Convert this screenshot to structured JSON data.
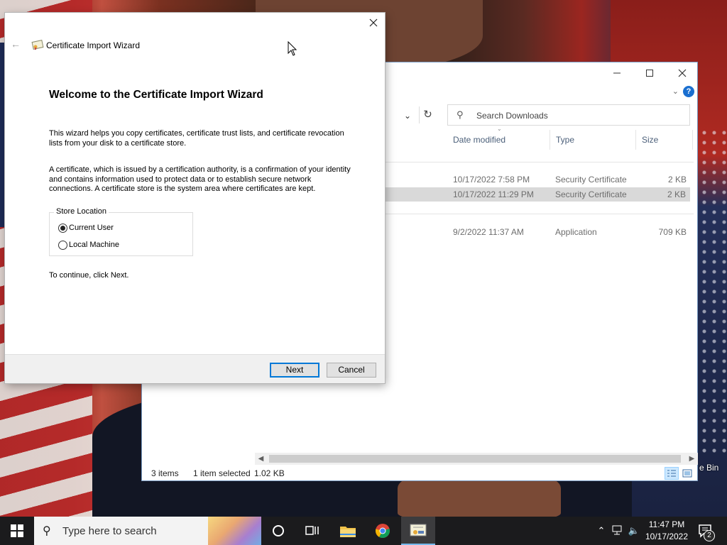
{
  "desktop": {
    "recycle_bin_label": "e Bin"
  },
  "explorer": {
    "search_placeholder": "Search Downloads",
    "columns": {
      "date": "Date modified",
      "type": "Type",
      "size": "Size"
    },
    "files": [
      {
        "date": "10/17/2022 7:58 PM",
        "type": "Security Certificate",
        "size": "2 KB",
        "selected": false
      },
      {
        "date": "10/17/2022 11:29 PM",
        "type": "Security Certificate",
        "size": "2 KB",
        "selected": true
      },
      {
        "date": "9/2/2022 11:37 AM",
        "type": "Application",
        "size": "709 KB",
        "selected": false
      }
    ],
    "status": {
      "items": "3 items",
      "selection": "1 item selected",
      "selection_size": "1.02 KB"
    }
  },
  "wizard": {
    "title": "Certificate Import Wizard",
    "heading": "Welcome to the Certificate Import Wizard",
    "para1_line1": "This wizard helps you copy certificates, certificate trust lists, and certificate revocation",
    "para1_line2": "lists from your disk to a certificate store.",
    "para2_line1": "A certificate, which is issued by a certification authority, is a confirmation of your identity",
    "para2_line2": "and contains information used to protect data or to establish secure network",
    "para2_line3": "connections. A certificate store is the system area where certificates are kept.",
    "store_location_label": "Store Location",
    "options": [
      {
        "label": "Current User",
        "checked": true
      },
      {
        "label": "Local Machine",
        "checked": false
      }
    ],
    "continue_text": "To continue, click Next.",
    "next_label": "Next",
    "cancel_label": "Cancel"
  },
  "taskbar": {
    "search_placeholder": "Type here to search",
    "time": "11:47 PM",
    "date": "10/17/2022",
    "notification_count": "2"
  }
}
